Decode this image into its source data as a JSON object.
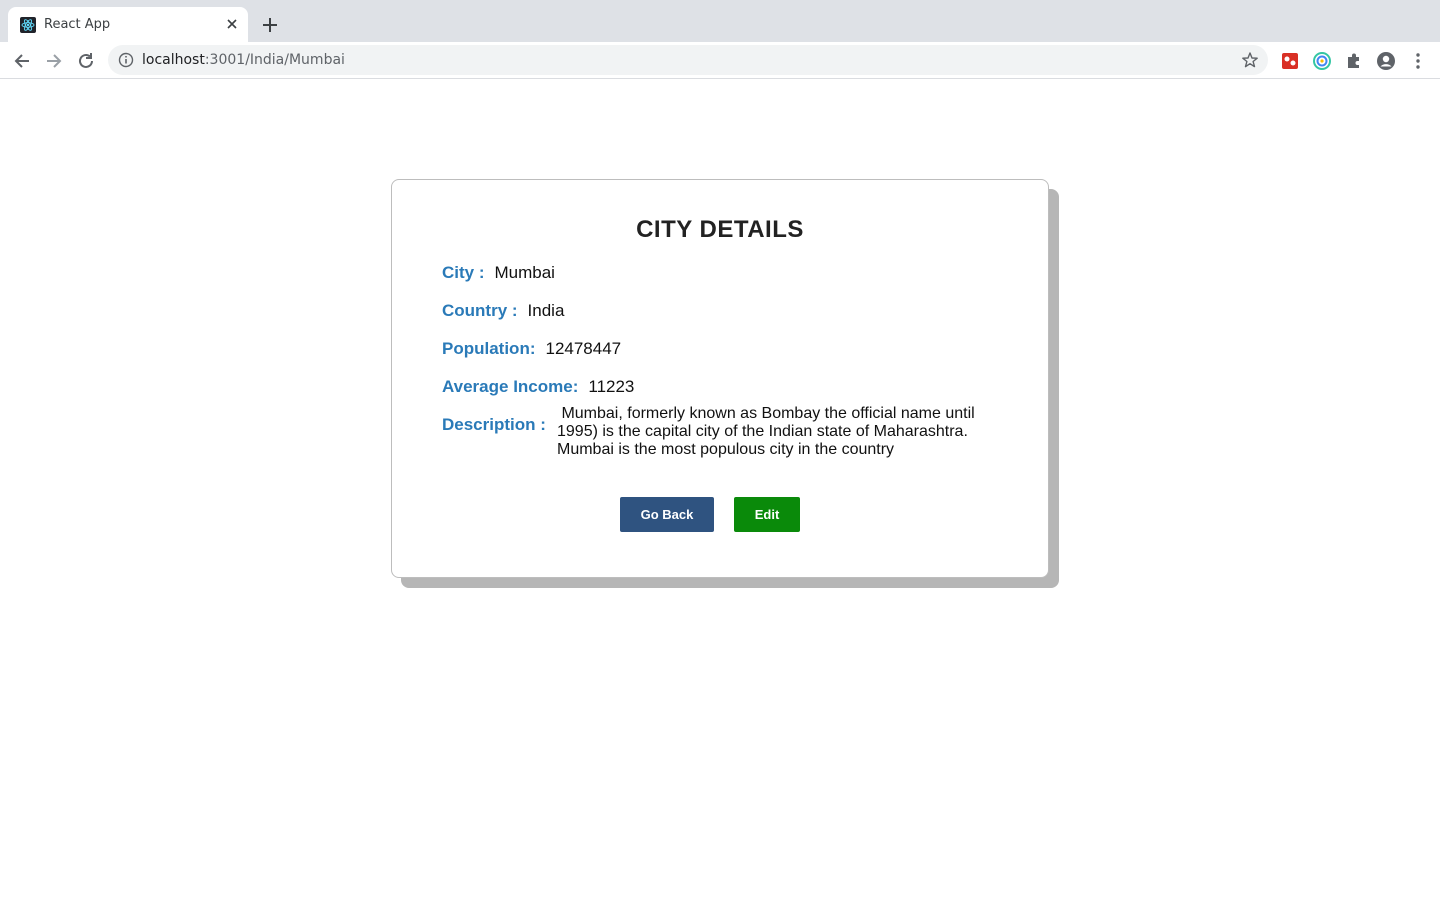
{
  "browser": {
    "tab_title": "React App",
    "url_host": "localhost",
    "url_path": ":3001/India/Mumbai",
    "icons": {
      "favicon": "react-icon",
      "close": "close-icon",
      "new_tab": "plus-icon",
      "back": "arrow-left-icon",
      "forward": "arrow-right-icon",
      "reload": "reload-icon",
      "info": "info-icon",
      "bookmark": "star-icon",
      "extensions": "puzzle-icon",
      "profile": "avatar-icon",
      "menu": "kebab-icon"
    }
  },
  "card": {
    "title": "CITY DETAILS",
    "city": {
      "label": "City :",
      "value": "Mumbai"
    },
    "country": {
      "label": "Country :",
      "value": "India"
    },
    "population": {
      "label": "Population:",
      "value": "12478447"
    },
    "income": {
      "label": "Average Income:",
      "value": "11223"
    },
    "description": {
      "label": "Description :",
      "value": " Mumbai, formerly known as Bombay the official name until 1995) is the capital city of the Indian state of Maharashtra. Mumbai is the most populous city in the country"
    },
    "buttons": {
      "back": "Go Back",
      "edit": "Edit"
    }
  },
  "colors": {
    "label": "#2a7ab8",
    "back_button": "#2f5380",
    "edit_button": "#0a8a0a"
  }
}
